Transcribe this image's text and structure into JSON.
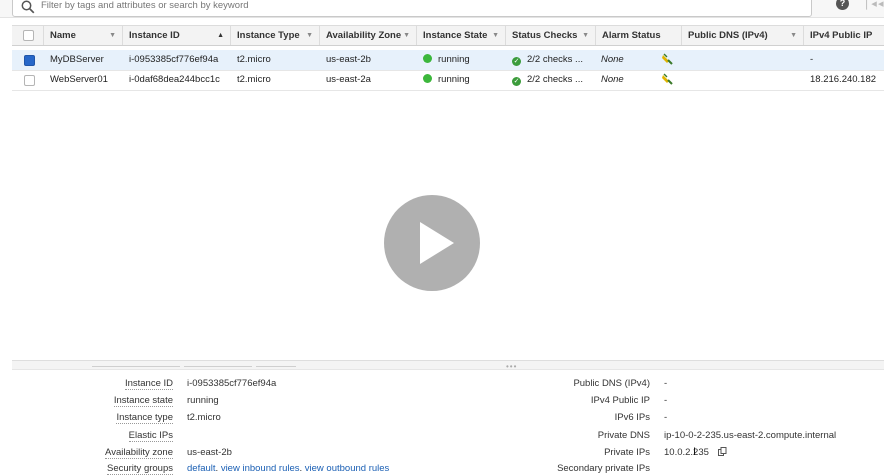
{
  "search": {
    "placeholder": "Filter by tags and attributes or search by keyword"
  },
  "toolbar": {
    "help_glyph": "?",
    "first_page_glyph": "❘◂",
    "prev_page_glyph": "◂"
  },
  "table": {
    "columns": [
      "Name",
      "Instance ID",
      "Instance Type",
      "Availability Zone",
      "Instance State",
      "Status Checks",
      "Alarm Status",
      "Public DNS (IPv4)",
      "IPv4 Public IP"
    ],
    "rows": [
      {
        "selected": true,
        "name": "MyDBServer",
        "instance_id": "i-0953385cf776ef94a",
        "instance_type": "t2.micro",
        "zone": "us-east-2b",
        "state": "running",
        "status_checks": "2/2 checks ...",
        "alarm_status": "None",
        "public_dns": "",
        "ipv4_public_ip": "-"
      },
      {
        "selected": false,
        "name": "WebServer01",
        "instance_id": "i-0daf68dea244bcc1c",
        "instance_type": "t2.micro",
        "zone": "us-east-2a",
        "state": "running",
        "status_checks": "2/2 checks ...",
        "alarm_status": "None",
        "public_dns": "",
        "ipv4_public_ip": "18.216.240.182"
      }
    ]
  },
  "colors": {
    "running": "#3cb73c",
    "selected_row": "#e7f1fb",
    "link": "#1a5fb4",
    "checkbox_checked": "#2667c9"
  },
  "details": {
    "left": [
      {
        "label": "Instance ID",
        "value": "i-0953385cf776ef94a"
      },
      {
        "label": "Instance state",
        "value": "running"
      },
      {
        "label": "Instance type",
        "value": "t2.micro"
      },
      {
        "label": "Elastic IPs",
        "value": ""
      },
      {
        "label": "Availability zone",
        "value": "us-east-2b"
      },
      {
        "label": "Security groups",
        "value": "default",
        "link1": "view inbound rules",
        "link2": "view outbound rules"
      }
    ],
    "right": [
      {
        "label": "Public DNS (IPv4)",
        "value": "-"
      },
      {
        "label": "IPv4 Public IP",
        "value": "-"
      },
      {
        "label": "IPv6 IPs",
        "value": "-"
      },
      {
        "label": "Private DNS",
        "value": "ip-10-0-2-235.us-east-2.compute.internal"
      },
      {
        "label": "Private IPs",
        "value": "10.0.2.235"
      },
      {
        "label": "Secondary private IPs",
        "value": ""
      }
    ]
  },
  "icons": [
    "search-icon",
    "help-icon",
    "first-page-icon",
    "prev-page-icon",
    "sort-icon",
    "running-status-icon",
    "status-check-icon",
    "alarm-bell-icon",
    "copy-icon",
    "play-icon",
    "text-cursor-icon"
  ]
}
